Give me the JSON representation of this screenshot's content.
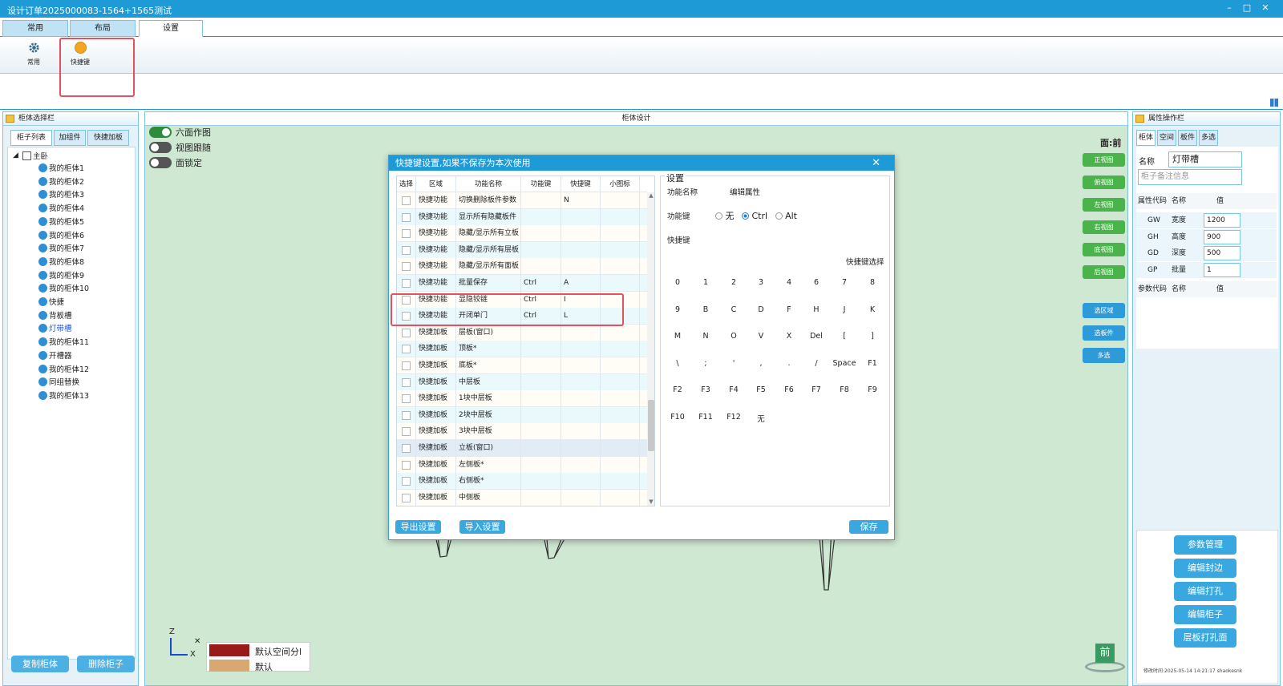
{
  "window": {
    "title": "设计订单2025000083-1564+1565测试",
    "controls": [
      "–",
      "□",
      "✕"
    ]
  },
  "tabs": [
    {
      "label": "常用"
    },
    {
      "label": "布局"
    },
    {
      "label": "设置"
    }
  ],
  "ribbon": {
    "items": [
      {
        "label": "常用",
        "icon": "gear-icon"
      },
      {
        "label": "快捷键",
        "icon": "shortcut-icon"
      }
    ]
  },
  "left_panel": {
    "title": "柜体选择栏",
    "tabs": [
      "柜子列表",
      "加组件",
      "快捷加板"
    ],
    "tree_root": "主卧",
    "items": [
      "我的柜体1",
      "我的柜体2",
      "我的柜体3",
      "我的柜体4",
      "我的柜体5",
      "我的柜体6",
      "我的柜体7",
      "我的柜体8",
      "我的柜体9",
      "我的柜体10",
      "快捷",
      "背板槽",
      "灯带槽",
      "我的柜体11",
      "开槽器",
      "我的柜体12",
      "同组替换",
      "我的柜体13"
    ],
    "selected_item": "灯带槽",
    "buttons": [
      "复制柜体",
      "删除柜子"
    ]
  },
  "center": {
    "title": "柜体设计",
    "toggles": [
      {
        "label": "六面作图",
        "on": true
      },
      {
        "label": "视图跟随",
        "on": false
      },
      {
        "label": "面锁定",
        "on": false
      }
    ],
    "face_label": "面:前",
    "view_buttons": [
      "正视图",
      "俯视图",
      "左视图",
      "右视图",
      "底视图",
      "后视图"
    ],
    "select_buttons": [
      "选区域",
      "选板件",
      "多选"
    ],
    "axes": {
      "z": "Z",
      "x": "X"
    },
    "legend": [
      "默认空间分l",
      "默认"
    ],
    "cube_label": "前"
  },
  "right_panel": {
    "title": "属性操作栏",
    "tabs": [
      "柜体",
      "空间",
      "板件",
      "多选"
    ],
    "name_label": "名称",
    "name_value": "灯带槽",
    "note_placeholder": "柜子备注信息",
    "props_header": [
      "属性代码",
      "名称",
      "值"
    ],
    "props": [
      {
        "code": "GW",
        "name": "宽度",
        "value": "1200"
      },
      {
        "code": "GH",
        "name": "高度",
        "value": "900"
      },
      {
        "code": "GD",
        "name": "深度",
        "value": "500"
      },
      {
        "code": "GP",
        "name": "批量",
        "value": "1"
      }
    ],
    "params_header": [
      "参数代码",
      "名称",
      "值"
    ],
    "buttons": [
      "参数管理",
      "编辑封边",
      "编辑打孔",
      "编辑柜子",
      "层板打孔面"
    ],
    "footer": "修改时间:2025-05-14 14:21:17 shaokesnk"
  },
  "dialog": {
    "title": "快捷键设置,如果不保存为本次使用",
    "close": "✕",
    "columns": [
      "选择",
      "区域",
      "功能名称",
      "功能键",
      "快捷键",
      "小图标"
    ],
    "rows": [
      {
        "area": "快捷功能",
        "name": "切换删除板件参数",
        "mod": "",
        "key": "N"
      },
      {
        "area": "快捷功能",
        "name": "显示所有隐藏板件",
        "mod": "",
        "key": ""
      },
      {
        "area": "快捷功能",
        "name": "隐藏/显示所有立板",
        "mod": "",
        "key": ""
      },
      {
        "area": "快捷功能",
        "name": "隐藏/显示所有层板",
        "mod": "",
        "key": ""
      },
      {
        "area": "快捷功能",
        "name": "隐藏/显示所有面板",
        "mod": "",
        "key": ""
      },
      {
        "area": "快捷功能",
        "name": "批量保存",
        "mod": "Ctrl",
        "key": "A"
      },
      {
        "area": "快捷功能",
        "name": "显隐铰链",
        "mod": "Ctrl",
        "key": "I"
      },
      {
        "area": "快捷功能",
        "name": "开闭单门",
        "mod": "Ctrl",
        "key": "L"
      },
      {
        "area": "快捷加板",
        "name": "层板(窗口)",
        "mod": "",
        "key": ""
      },
      {
        "area": "快捷加板",
        "name": "顶板*",
        "mod": "",
        "key": ""
      },
      {
        "area": "快捷加板",
        "name": "底板*",
        "mod": "",
        "key": ""
      },
      {
        "area": "快捷加板",
        "name": "中层板",
        "mod": "",
        "key": ""
      },
      {
        "area": "快捷加板",
        "name": "1块中层板",
        "mod": "",
        "key": ""
      },
      {
        "area": "快捷加板",
        "name": "2块中层板",
        "mod": "",
        "key": ""
      },
      {
        "area": "快捷加板",
        "name": "3块中层板",
        "mod": "",
        "key": ""
      },
      {
        "area": "快捷加板",
        "name": "立板(窗口)",
        "mod": "",
        "key": ""
      },
      {
        "area": "快捷加板",
        "name": "左侧板*",
        "mod": "",
        "key": ""
      },
      {
        "area": "快捷加板",
        "name": "右侧板*",
        "mod": "",
        "key": ""
      },
      {
        "area": "快捷加板",
        "name": "中侧板",
        "mod": "",
        "key": ""
      }
    ],
    "settings": {
      "title": "设置",
      "func_name_label": "功能名称",
      "func_name_value": "编辑属性",
      "mod_label": "功能键",
      "mod_options": [
        "无",
        "Ctrl",
        "Alt"
      ],
      "mod_selected": "Ctrl",
      "shortcut_label": "快捷键",
      "picker_label": "快捷键选择",
      "keys": [
        "0",
        "1",
        "2",
        "3",
        "4",
        "6",
        "7",
        "8",
        "9",
        "B",
        "C",
        "D",
        "F",
        "H",
        "J",
        "K",
        "M",
        "N",
        "O",
        "V",
        "X",
        "Del",
        "[",
        "]",
        "\\",
        ";",
        "'",
        ",",
        ".",
        "/",
        "Space",
        "F1",
        "F2",
        "F3",
        "F4",
        "F5",
        "F6",
        "F7",
        "F8",
        "F9",
        "F10",
        "F11",
        "F12",
        "无"
      ]
    },
    "buttons": {
      "export": "导出设置",
      "import": "导入设置",
      "save": "保存"
    }
  }
}
